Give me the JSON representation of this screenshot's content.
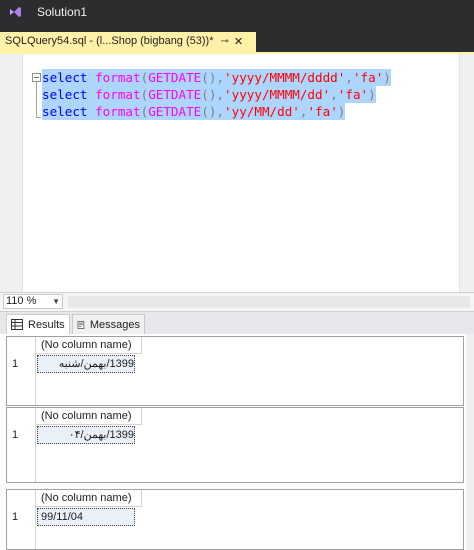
{
  "window": {
    "title": "Solution1"
  },
  "tab": {
    "label": "SQLQuery54.sql - (l...Shop (bigbang (53))*",
    "pin_glyph": "⊸",
    "close_glyph": "✕"
  },
  "editor": {
    "lines": [
      {
        "kw": "select",
        "fn": "format",
        "open": "(",
        "func": "GETDATE",
        "call": "()",
        "comma1": ",",
        "fmt": "'yyyy/MMMM/dddd'",
        "comma2": ",",
        "culture": "'fa'",
        "close": ")"
      },
      {
        "kw": "select",
        "fn": "format",
        "open": "(",
        "func": "GETDATE",
        "call": "()",
        "comma1": ",",
        "fmt": "'yyyy/MMMM/dd'",
        "comma2": ",",
        "culture": "'fa'",
        "close": ")"
      },
      {
        "kw": "select",
        "fn": "format",
        "open": "(",
        "func": "GETDATE",
        "call": "()",
        "comma1": ",",
        "fmt": "'yy/MM/dd'",
        "comma2": ",",
        "culture": "'fa'",
        "close": ")"
      }
    ]
  },
  "status": {
    "zoom": "110 %"
  },
  "results_tabs": {
    "results": "Results",
    "messages": "Messages"
  },
  "grids": [
    {
      "header": "(No column name)",
      "row_number": "1",
      "value": "1399/بهمن/شنبه"
    },
    {
      "header": "(No column name)",
      "row_number": "1",
      "value": "1399/بهمن/۰۴"
    },
    {
      "header": "(No column name)",
      "row_number": "1",
      "value": "99/11/04"
    }
  ],
  "colors": {
    "keyword": "#0000ff",
    "function": "#ff00ff",
    "string": "#ff0000",
    "punctuation": "#808080",
    "selection": "#add6ff",
    "active_tab": "#fff1a8"
  }
}
